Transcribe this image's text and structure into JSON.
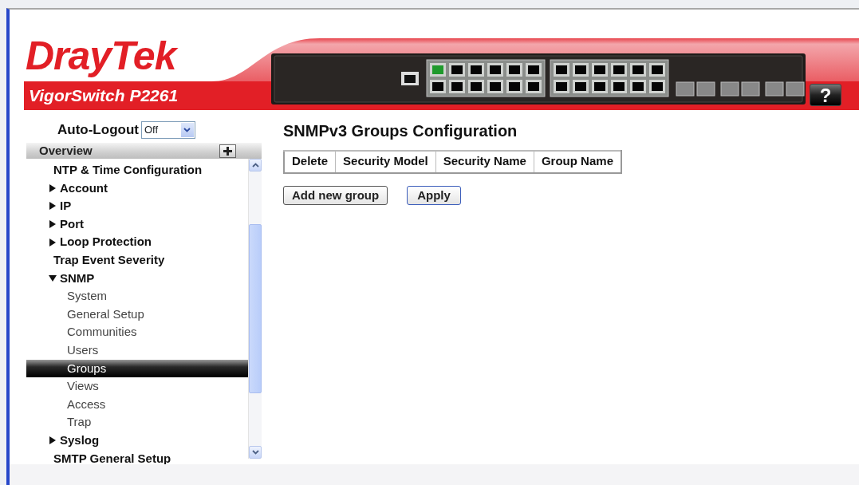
{
  "header": {
    "logo": "DrayTek",
    "model": "VigorSwitch P2261",
    "help_button": "?"
  },
  "sidebar": {
    "auto_logout": {
      "label": "Auto-Logout",
      "value": "Off"
    },
    "section": "Overview",
    "tree": [
      {
        "label": "NTP & Time Configuration",
        "kind": "leaf",
        "selected": false
      },
      {
        "label": "Account",
        "kind": "folder",
        "expanded": false,
        "selected": false
      },
      {
        "label": "IP",
        "kind": "folder",
        "expanded": false,
        "selected": false
      },
      {
        "label": "Port",
        "kind": "folder",
        "expanded": false,
        "selected": false
      },
      {
        "label": "Loop Protection",
        "kind": "folder",
        "expanded": false,
        "selected": false
      },
      {
        "label": "Trap Event Severity",
        "kind": "leaf",
        "selected": false
      },
      {
        "label": "SNMP",
        "kind": "folder",
        "expanded": true,
        "selected": false,
        "children": [
          {
            "label": "System",
            "kind": "leaf",
            "selected": false
          },
          {
            "label": "General Setup",
            "kind": "leaf",
            "selected": false
          },
          {
            "label": "Communities",
            "kind": "leaf",
            "selected": false
          },
          {
            "label": "Users",
            "kind": "leaf",
            "selected": false
          },
          {
            "label": "Groups",
            "kind": "leaf",
            "selected": true
          },
          {
            "label": "Views",
            "kind": "leaf",
            "selected": false
          },
          {
            "label": "Access",
            "kind": "leaf",
            "selected": false
          },
          {
            "label": "Trap",
            "kind": "leaf",
            "selected": false
          }
        ]
      },
      {
        "label": "Syslog",
        "kind": "folder",
        "expanded": false,
        "selected": false
      },
      {
        "label": "SMTP General Setup",
        "kind": "leaf",
        "selected": false
      }
    ]
  },
  "main": {
    "title": "SNMPv3 Groups Configuration",
    "table": {
      "columns": [
        "Delete",
        "Security Model",
        "Security Name",
        "Group Name"
      ]
    },
    "buttons": [
      "Add new group",
      "Apply"
    ]
  }
}
